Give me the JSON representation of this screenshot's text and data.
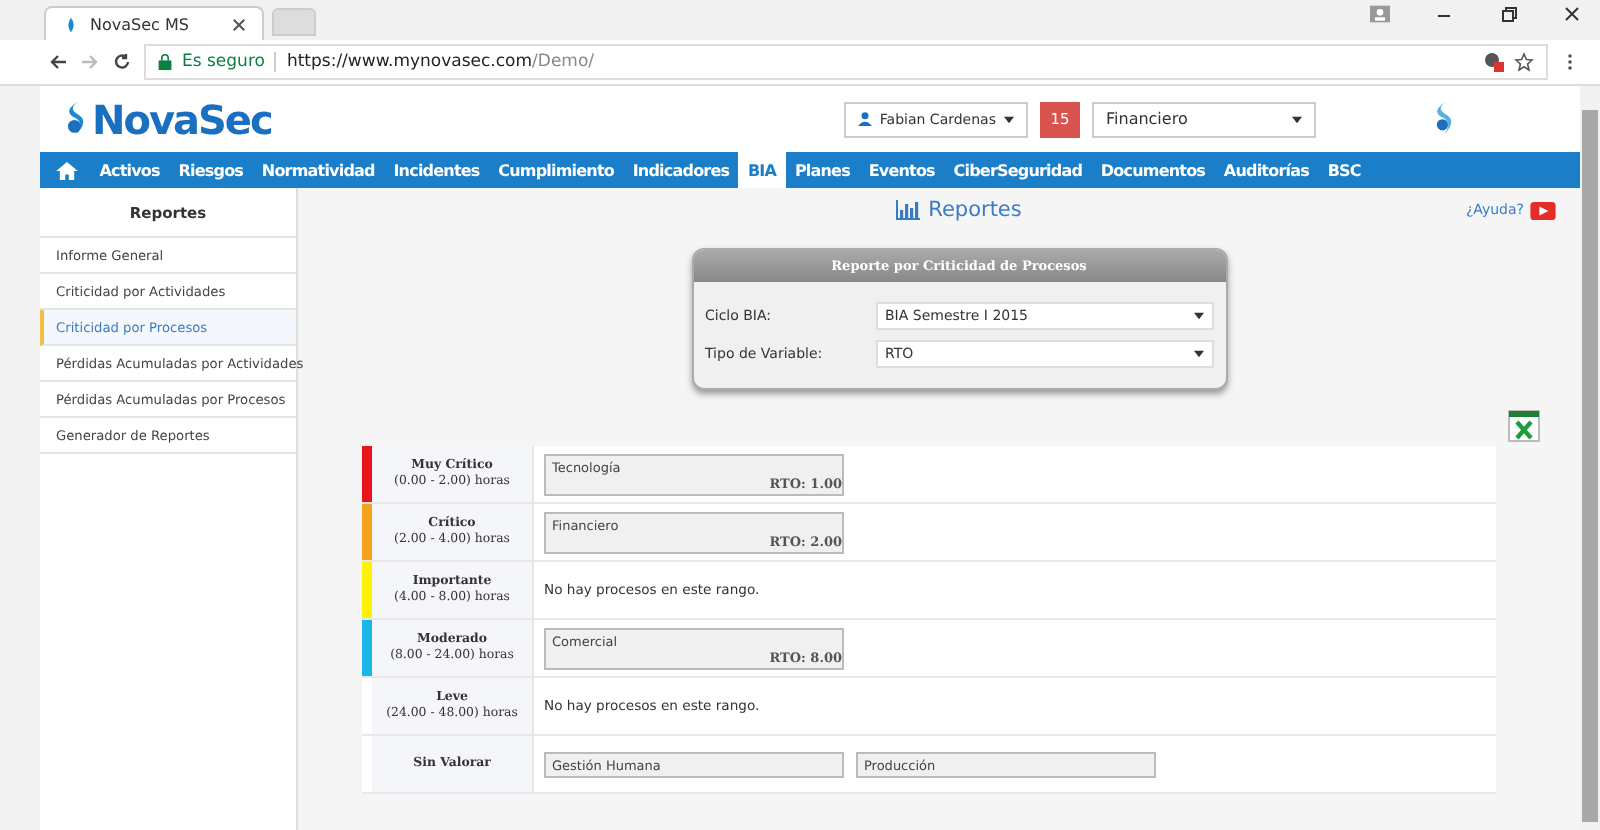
{
  "browser": {
    "tab_title": "NovaSec MS",
    "secure_label": "Es seguro",
    "url_host": "https://www.mynovasec.com",
    "url_path": "/Demo/"
  },
  "header": {
    "logo": "NovaSec",
    "user": "Fabian Cardenas",
    "notifications": "15",
    "company": "Financiero"
  },
  "nav": [
    {
      "label": "Activos",
      "selected": false
    },
    {
      "label": "Riesgos",
      "selected": false
    },
    {
      "label": "Normatividad",
      "selected": false
    },
    {
      "label": "Incidentes",
      "selected": false
    },
    {
      "label": "Cumplimiento",
      "selected": false
    },
    {
      "label": "Indicadores",
      "selected": false
    },
    {
      "label": "BIA",
      "selected": true
    },
    {
      "label": "Planes",
      "selected": false
    },
    {
      "label": "Eventos",
      "selected": false
    },
    {
      "label": "CiberSeguridad",
      "selected": false
    },
    {
      "label": "Documentos",
      "selected": false
    },
    {
      "label": "Auditorías",
      "selected": false
    },
    {
      "label": "BSC",
      "selected": false
    }
  ],
  "sidebar": {
    "title": "Reportes",
    "items": [
      {
        "label": "Informe General",
        "selected": false
      },
      {
        "label": "Criticidad por Actividades",
        "selected": false
      },
      {
        "label": "Criticidad por Procesos",
        "selected": true
      },
      {
        "label": "Pérdidas Acumuladas por Actividades",
        "selected": false
      },
      {
        "label": "Pérdidas Acumuladas por Procesos",
        "selected": false
      },
      {
        "label": "Generador de Reportes",
        "selected": false
      }
    ]
  },
  "page_title": "Reportes",
  "help": "¿Ayuda?",
  "filter": {
    "title": "Reporte por Criticidad de Procesos",
    "fields": [
      {
        "label": "Ciclo BIA:",
        "value": "BIA Semestre I 2015"
      },
      {
        "label": "Tipo de Variable:",
        "value": "RTO"
      }
    ]
  },
  "levels": [
    {
      "name": "Muy Crítico",
      "range": "(0.00 - 2.00) horas",
      "color": "#e8151b",
      "processes": [
        {
          "name": "Tecnología",
          "rto": "RTO: 1.00"
        }
      ]
    },
    {
      "name": "Crítico",
      "range": "(2.00 - 4.00) horas",
      "color": "#f5a11c",
      "processes": [
        {
          "name": "Financiero",
          "rto": "RTO: 2.00"
        }
      ]
    },
    {
      "name": "Importante",
      "range": "(4.00 - 8.00) horas",
      "color": "#fff200",
      "empty_message": "No hay procesos en este rango."
    },
    {
      "name": "Moderado",
      "range": "(8.00 - 24.00) horas",
      "color": "#1cb5e8",
      "processes": [
        {
          "name": "Comercial",
          "rto": "RTO: 8.00"
        }
      ]
    },
    {
      "name": "Leve",
      "range": "(24.00 - 48.00) horas",
      "empty_message": "No hay procesos en este rango."
    },
    {
      "name": "Sin Valorar",
      "processes": [
        {
          "name": "Gestión Humana"
        },
        {
          "name": "Producción"
        }
      ]
    }
  ]
}
